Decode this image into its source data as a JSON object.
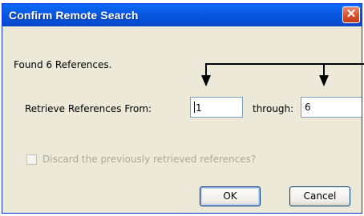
{
  "dialog": {
    "title": "Confirm Remote Search",
    "close_glyph": "✕",
    "found_text": "Found 6 References.",
    "retrieve_label": "Retrieve References From:",
    "from_value": "1",
    "through_label": "through:",
    "through_value": "6",
    "discard_label": "Discard the previously retrieved references?",
    "discard_checked": false,
    "ok_label": "OK",
    "cancel_label": "Cancel"
  },
  "colors": {
    "titlebar": "#0650d9",
    "close": "#d5512d",
    "dialog_bg": "#ece9d8"
  }
}
